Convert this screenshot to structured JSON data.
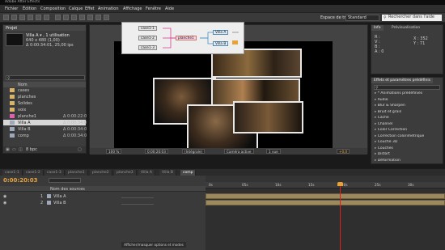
{
  "window": {
    "title": "Adobe After Effects"
  },
  "menu": [
    "Fichier",
    "Édition",
    "Composition",
    "Calque",
    "Effet",
    "Animation",
    "Affichage",
    "Fenêtre",
    "Aide"
  ],
  "toolbar": {
    "workspace_label": "Espace de travail :",
    "workspace_value": "Standard",
    "help_placeholder": "Rechercher dans l'aide"
  },
  "project": {
    "tab": "Projet",
    "selected_name": "Villa A ▾ , 1 utilisation",
    "selected_size": "640 x 480 (1,00)",
    "selected_duration": "Δ 0:00:34:01, 25,00 ips",
    "col_name": "Nom",
    "items": [
      {
        "name": "cases",
        "dur": "",
        "color": "#d8b36a",
        "selected": false
      },
      {
        "name": "planches",
        "dur": "",
        "color": "#d8b36a",
        "selected": false
      },
      {
        "name": "Solides",
        "dur": "",
        "color": "#d8b36a",
        "selected": false
      },
      {
        "name": "voix",
        "dur": "",
        "color": "#d8b36a",
        "selected": false
      },
      {
        "name": "planche1",
        "dur": "Δ 0:00:22:0",
        "color": "#e05fb0",
        "selected": false
      },
      {
        "name": "Villa A",
        "dur": "Δ 0:00:34:0",
        "color": "#9ea8b8",
        "selected": true
      },
      {
        "name": "Villa B",
        "dur": "Δ 0:00:34:0",
        "color": "#9ea8b8",
        "selected": false
      },
      {
        "name": "comp",
        "dur": "Δ 0:00:34:0",
        "color": "#9ea8b8",
        "selected": false
      }
    ],
    "footer_bpc": "8 bpc"
  },
  "flowchart": {
    "nodes": [
      "case1-1",
      "case1-2",
      "case1-3",
      "planche1",
      "Villa A",
      "Villa B"
    ]
  },
  "viewer": {
    "zoom": "100 %",
    "time": "0:00:20:03",
    "quality": "(Intégrale)",
    "camera": "Caméra active",
    "views": "1 vue",
    "offset": "+0,0"
  },
  "info": {
    "tab1": "Info",
    "tab2": "Prévisualisation",
    "r": "R :",
    "v": "V :",
    "b": "B :",
    "a": "A : 0",
    "x": "X : 352",
    "y": "Y : 71"
  },
  "effects": {
    "tab": "Effets et paramètres prédéfinis",
    "items": [
      "* Animations prédéfinies",
      "Audio",
      "Blur & Sharpen",
      "Bruit et grain",
      "Cache",
      "Channel",
      "Color Correction",
      "Correction colorimétrique",
      "Couche 3D",
      "Couches",
      "Distort",
      "Déformation"
    ]
  },
  "timeline": {
    "tabs": [
      "case1-1",
      "case1-2",
      "case1-3",
      "planche1",
      "planche2",
      "planche3",
      "Villa A",
      "Villa B",
      "comp"
    ],
    "active_tab": "comp",
    "current_time": "0:00:20:03",
    "col_source": "Nom des sources",
    "layers": [
      {
        "num": "1",
        "name": "Villa A"
      },
      {
        "num": "2",
        "name": "Villa B"
      }
    ],
    "ruler": [
      "0s",
      "05s",
      "10s",
      "15s",
      "20s",
      "25s",
      "30s"
    ],
    "footer_toggle": "Afficher/masquer options et modes"
  },
  "colors": {
    "accent_orange": "#e8a23a",
    "playhead": "#e31c1c",
    "layer_bar": "#9c8a5e"
  }
}
